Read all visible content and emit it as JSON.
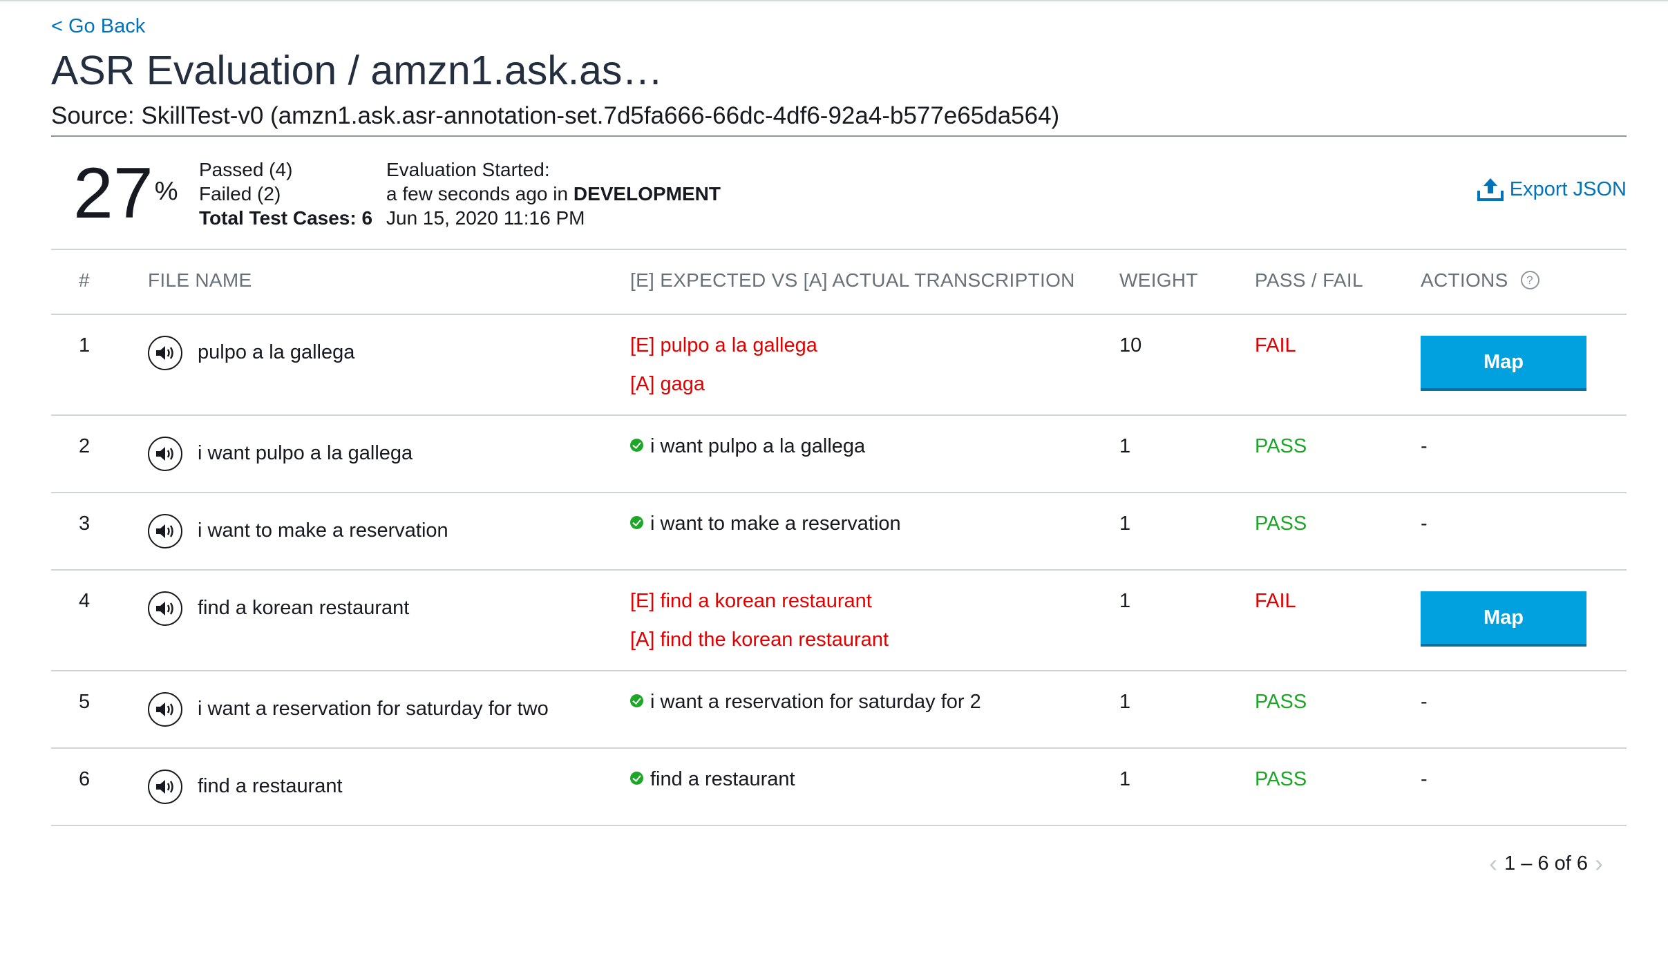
{
  "nav": {
    "go_back": "< Go Back"
  },
  "header": {
    "title": "ASR Evaluation / amzn1.ask.as…",
    "source": "Source: SkillTest-v0 (amzn1.ask.asr-annotation-set.7d5fa666-66dc-4df6-92a4-b577e65da564)"
  },
  "summary": {
    "score": "27",
    "score_unit": "%",
    "passed": "Passed (4)",
    "failed": "Failed (2)",
    "total": "Total Test Cases: 6",
    "started_label": "Evaluation Started:",
    "started_when": "a few seconds ago in ",
    "stage": "DEVELOPMENT",
    "started_date": "Jun 15, 2020 11:16 PM"
  },
  "export": {
    "label": "Export JSON",
    "icon": "upload-icon"
  },
  "table": {
    "headers": {
      "num": "#",
      "file_name": "FILE NAME",
      "transcription": "[E] EXPECTED VS [A] ACTUAL TRANSCRIPTION",
      "weight": "WEIGHT",
      "pass_fail": "PASS / FAIL",
      "actions": "ACTIONS",
      "help": "?"
    },
    "rows": [
      {
        "num": "1",
        "file": "pulpo a la gallega",
        "expected": "[E] pulpo a la gallega",
        "actual": "[A] gaga",
        "match": "",
        "weight": "10",
        "result": "FAIL",
        "action": "Map"
      },
      {
        "num": "2",
        "file": "i want pulpo a la gallega",
        "expected": "",
        "actual": "",
        "match": "i want pulpo a la gallega",
        "weight": "1",
        "result": "PASS",
        "action": "-"
      },
      {
        "num": "3",
        "file": "i want to make a reservation",
        "expected": "",
        "actual": "",
        "match": "i want to make a reservation",
        "weight": "1",
        "result": "PASS",
        "action": "-"
      },
      {
        "num": "4",
        "file": "find a korean restaurant",
        "expected": "[E] find a korean restaurant",
        "actual": "[A] find the korean restaurant",
        "match": "",
        "weight": "1",
        "result": "FAIL",
        "action": "Map"
      },
      {
        "num": "5",
        "file": "i want a reservation for saturday for two",
        "expected": "",
        "actual": "",
        "match": "i want a reservation for saturday for 2",
        "weight": "1",
        "result": "PASS",
        "action": "-"
      },
      {
        "num": "6",
        "file": "find a restaurant",
        "expected": "",
        "actual": "",
        "match": "find a restaurant",
        "weight": "1",
        "result": "PASS",
        "action": "-"
      }
    ]
  },
  "pagination": {
    "label": "1 – 6 of 6"
  },
  "colors": {
    "link": "#0073bb",
    "fail": "#e00000",
    "pass": "#1da727",
    "button": "#00a1de"
  }
}
